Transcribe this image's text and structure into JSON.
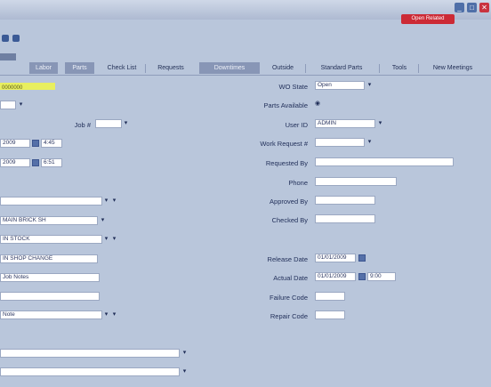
{
  "window": {
    "open_button": "Open Related",
    "min_glyph": "_",
    "max_glyph": "□",
    "close_glyph": "✕"
  },
  "tabs": [
    {
      "label": "Labor"
    },
    {
      "label": "Parts"
    },
    {
      "label": "Check List"
    },
    {
      "label": "Requests"
    },
    {
      "label": "Downtimes"
    },
    {
      "label": "Outside"
    },
    {
      "label": "Standard Parts"
    },
    {
      "label": "Tools"
    },
    {
      "label": "New Meetings"
    }
  ],
  "left": {
    "work_order_id": "0000000",
    "d1": "",
    "d2": "",
    "date1": "2009",
    "time1": "4:45",
    "date2": "2009",
    "time2": "6:51",
    "asset1": "",
    "asset2": "MAIN BRICK SH",
    "asset3": "IN STOCK",
    "loc1": "IN SHOP CHANGE",
    "loc2": "Job Notes",
    "loc3": "",
    "loc4": "Note",
    "wide1": "",
    "wide2": "",
    "job_label": "Job #"
  },
  "right": {
    "labels": {
      "wo_state": "WO State",
      "parts_available": "Parts Available",
      "user_id": "User ID",
      "work_request": "Work Request #",
      "requested_by": "Requested By",
      "phone": "Phone",
      "approved_by": "Approved By",
      "checked_by": "Checked By",
      "release_date": "Release Date",
      "actual_date": "Actual Date",
      "failure_code": "Failure Code",
      "repair_code": "Repair Code"
    },
    "values": {
      "wo_state": "Open",
      "user_id": "ADMIN",
      "work_request": "",
      "requested_by": "",
      "phone": "",
      "approved_by": "",
      "checked_by": "",
      "release_date": "01/01/2009",
      "actual_date": "01/01/2009",
      "actual_time": "9:00",
      "failure_code": "",
      "repair_code": ""
    }
  },
  "icons": {
    "dropdown": "▾",
    "radio": "◉"
  }
}
